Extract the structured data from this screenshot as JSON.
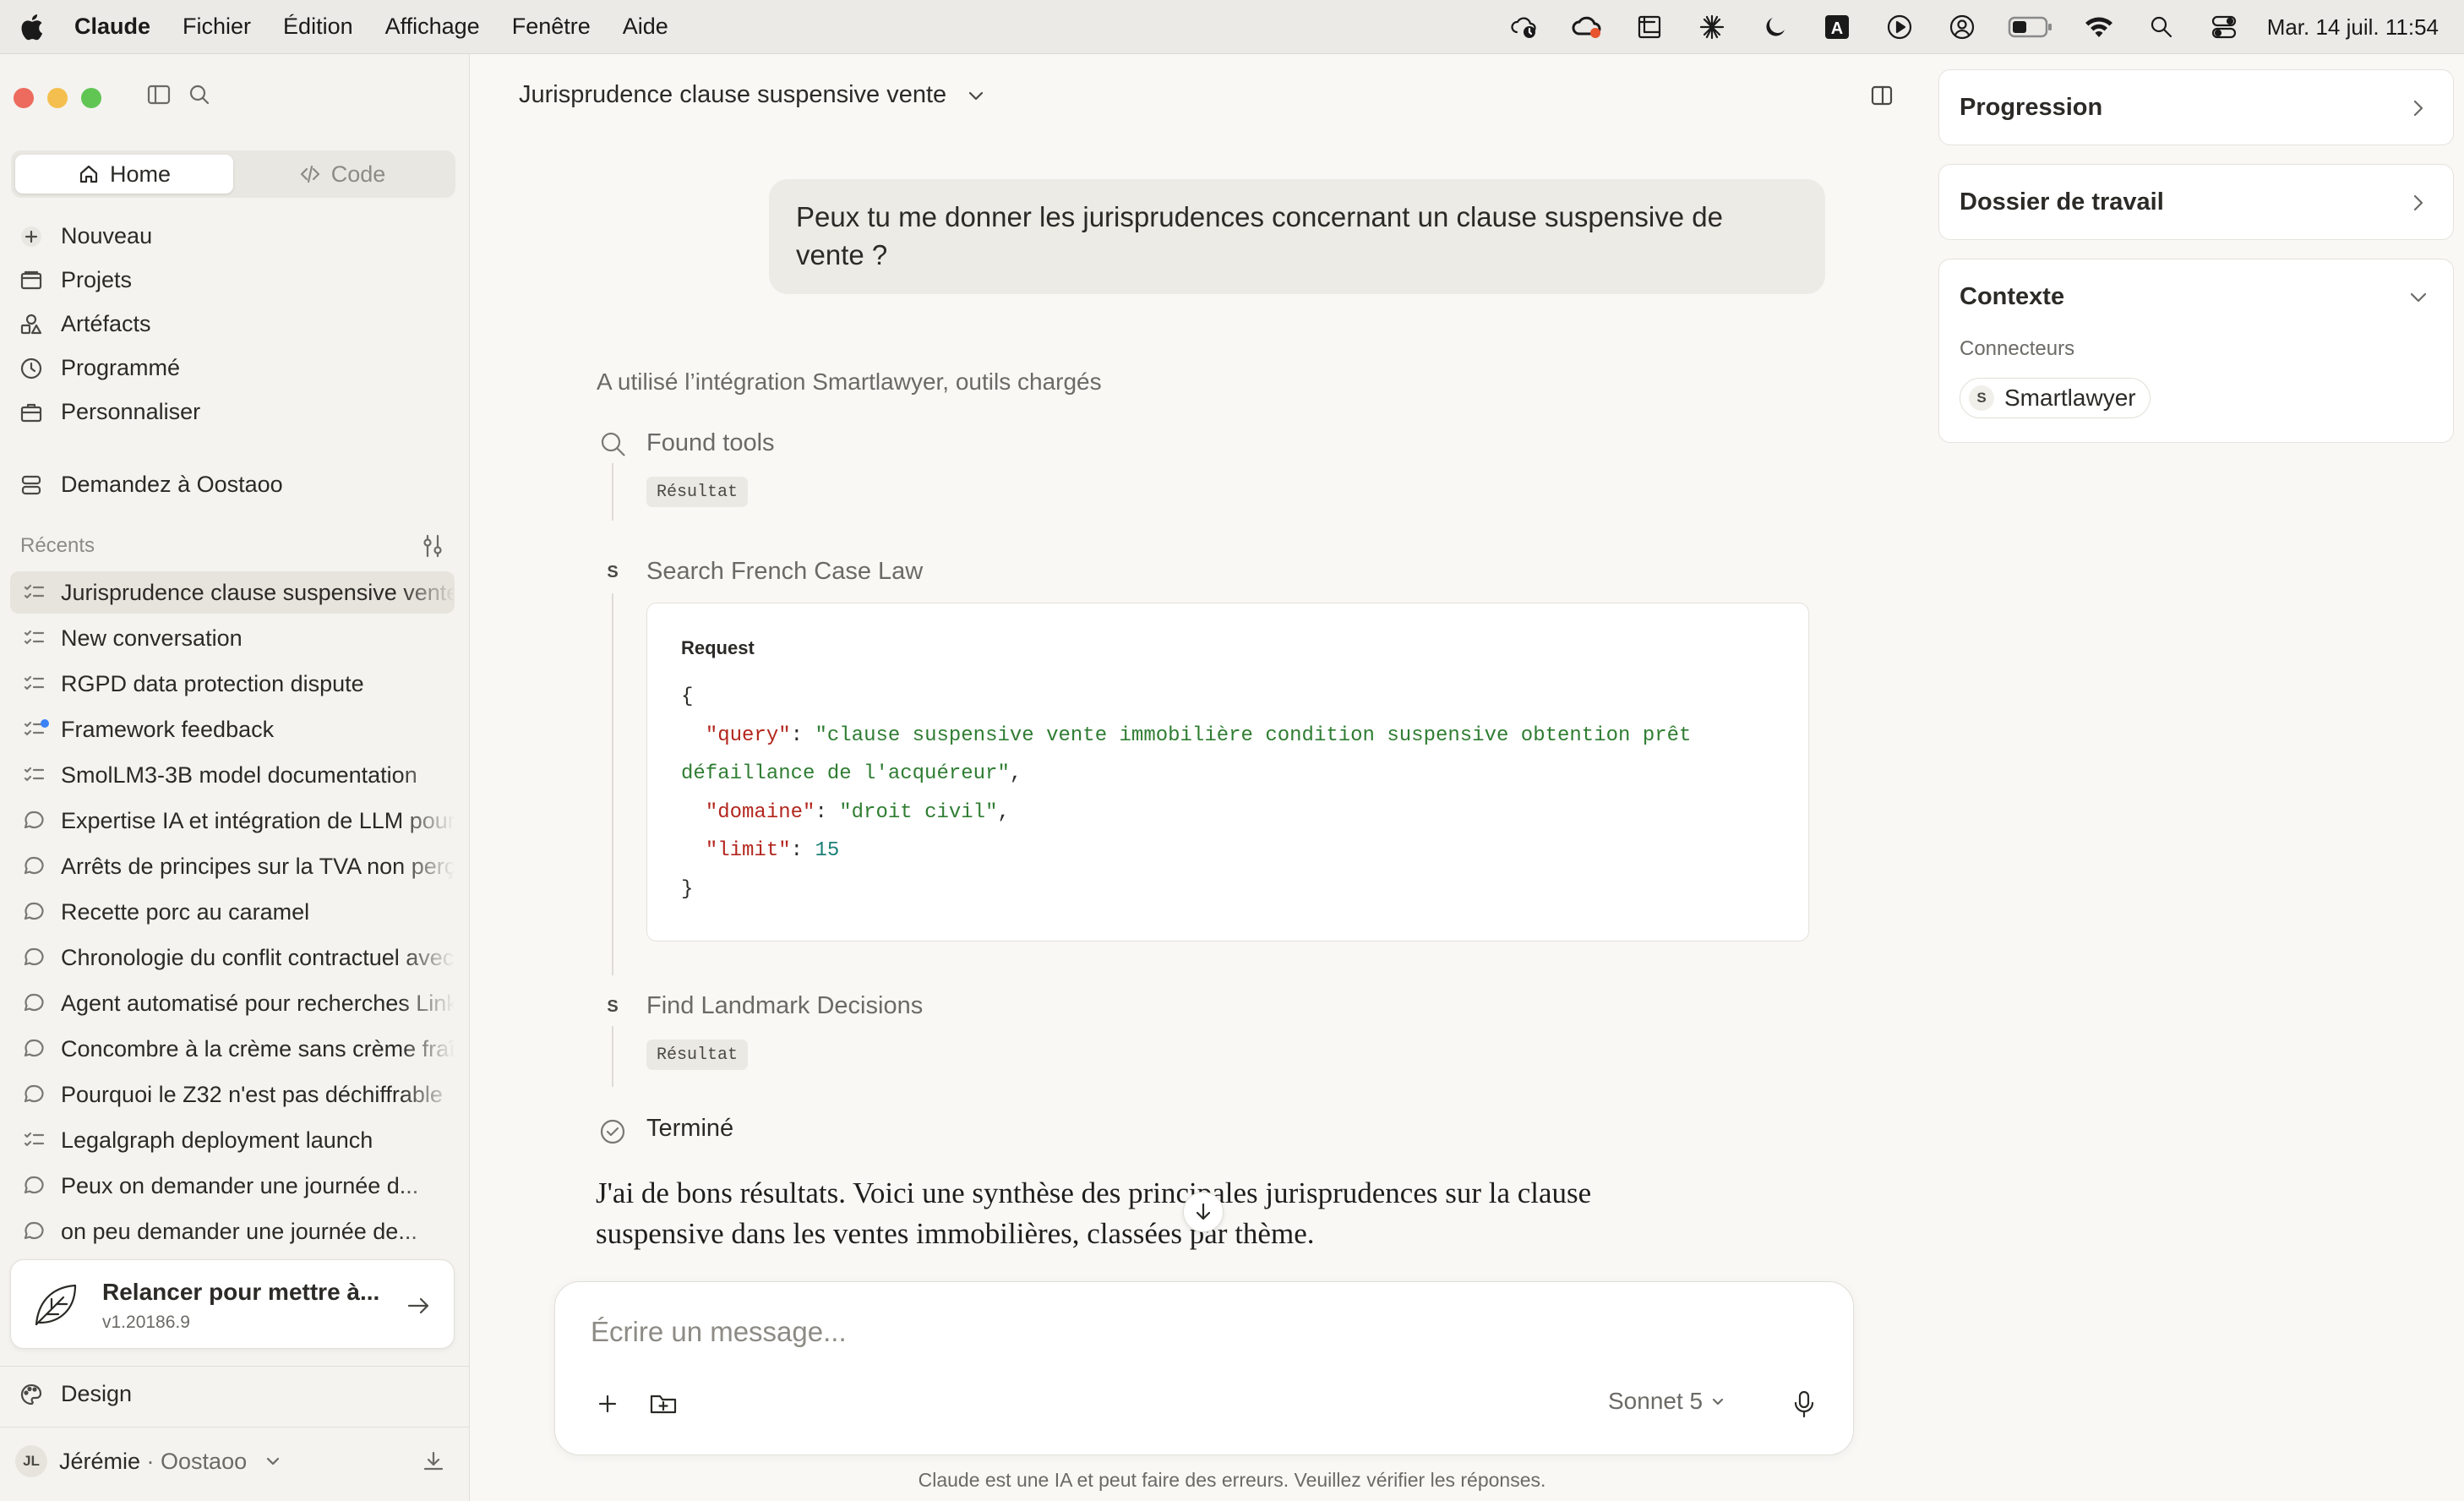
{
  "menubar": {
    "app": "Claude",
    "items": [
      "Fichier",
      "Édition",
      "Affichage",
      "Fenêtre",
      "Aide"
    ],
    "clock": "Mar. 14 juil. 11:54",
    "status_icons": [
      "cloud-timer-icon",
      "creative-cloud-icon",
      "crop-icon",
      "claude-asterisk-icon",
      "moon-icon",
      "keyboard-a-icon",
      "play-circle-icon",
      "user-circle-icon",
      "battery-icon",
      "wifi-icon",
      "search-icon",
      "control-center-icon"
    ]
  },
  "sidebar": {
    "segments": {
      "home": "Home",
      "code": "Code"
    },
    "nav": [
      {
        "label": "Nouveau",
        "icon": "plus-icon"
      },
      {
        "label": "Projets",
        "icon": "folder-icon"
      },
      {
        "label": "Artéfacts",
        "icon": "shapes-icon"
      },
      {
        "label": "Programmé",
        "icon": "clock-icon"
      },
      {
        "label": "Personnaliser",
        "icon": "briefcase-icon"
      },
      {
        "label": "Demandez à Oostaoo",
        "icon": "database-icon"
      }
    ],
    "recents_title": "Récents",
    "recents": [
      {
        "label": "Jurisprudence clause suspensive vente",
        "icon": "task-list-icon",
        "active": true
      },
      {
        "label": "New conversation",
        "icon": "task-list-icon"
      },
      {
        "label": "RGPD data protection dispute",
        "icon": "task-list-icon"
      },
      {
        "label": "Framework feedback",
        "icon": "task-list-icon",
        "unread": true
      },
      {
        "label": "SmolLM3-3B model documentation",
        "icon": "task-list-icon"
      },
      {
        "label": "Expertise IA et intégration de LLM pour",
        "icon": "chat-bubble-icon"
      },
      {
        "label": "Arrêts de principes sur la TVA non perçue",
        "icon": "chat-bubble-icon"
      },
      {
        "label": "Recette porc au caramel",
        "icon": "chat-bubble-icon"
      },
      {
        "label": "Chronologie du conflit contractuel avec",
        "icon": "chat-bubble-icon"
      },
      {
        "label": "Agent automatisé pour recherches Linked",
        "icon": "chat-bubble-icon"
      },
      {
        "label": "Concombre à la crème sans crème fraîche",
        "icon": "chat-bubble-icon"
      },
      {
        "label": "Pourquoi le Z32 n'est pas déchiffrable",
        "icon": "chat-bubble-icon"
      },
      {
        "label": "Legalgraph deployment launch",
        "icon": "task-list-icon"
      },
      {
        "label": "Peux on demander une journée d...",
        "icon": "chat-bubble-icon"
      },
      {
        "label": "on peu demander une journée de...",
        "icon": "chat-bubble-icon"
      }
    ],
    "update": {
      "title": "Relancer pour mettre à...",
      "version": "v1.20186.9"
    },
    "design": "Design",
    "user": {
      "initials": "JL",
      "name": "Jérémie",
      "separator": " · ",
      "org": "Oostaoo"
    }
  },
  "conversation": {
    "title": "Jurisprudence clause suspensive vente",
    "user_message": "Peux tu me donner les jurisprudences concernant un clause suspensive de vente ?",
    "tool_intro": "A utilisé l’intégration Smartlawyer, outils chargés",
    "steps": {
      "found_tools": "Found tools",
      "result_pill": "Résultat",
      "search": "Search French Case Law",
      "landmark": "Find Landmark Decisions",
      "done": "Terminé",
      "step_badge": "S"
    },
    "request": {
      "label": "Request",
      "query_key": "\"query\"",
      "query_value_line1": "\"clause suspensive vente immobilière condition suspensive obtention prêt",
      "query_value_line2": "défaillance de l'acquéreur\"",
      "domaine_key": "\"domaine\"",
      "domaine_value": "\"droit civil\"",
      "limit_key": "\"limit\"",
      "limit_value": "15"
    },
    "answer": "J'ai de bons résultats. Voici une synthèse des principales jurisprudences sur la clause suspensive dans les ventes immobilières, classées par thème."
  },
  "composer": {
    "placeholder": "Écrire un message...",
    "model": "Sonnet 5",
    "disclaimer": "Claude est une IA et peut faire des erreurs. Veuillez vérifier les réponses."
  },
  "right_panel": {
    "progression": "Progression",
    "dossier": "Dossier de travail",
    "contexte": "Contexte",
    "connecteurs": "Connecteurs",
    "connector": {
      "badge": "S",
      "name": "Smartlawyer"
    }
  },
  "colors": {
    "traffic_red": "#ed6a5e",
    "traffic_yellow": "#f5bf4f",
    "traffic_green": "#61c554",
    "json_key": "#b3261e",
    "json_string": "#2f7d32",
    "json_number": "#1a7f78"
  }
}
